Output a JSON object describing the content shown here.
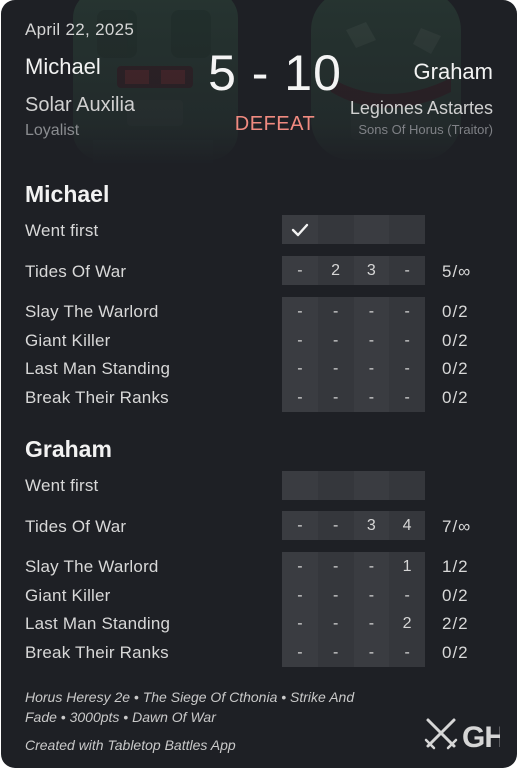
{
  "header": {
    "date": "April 22, 2025",
    "score": "5 - 10",
    "result": "DEFEAT",
    "player1": {
      "name": "Michael",
      "faction": "Solar Auxilia",
      "allegiance": "Loyalist"
    },
    "player2": {
      "name": "Graham",
      "faction": "Legiones Astartes",
      "sub": "Sons Of Horus (Traitor)"
    }
  },
  "sections": [
    {
      "title": "Michael",
      "went_first": {
        "label": "Went first",
        "checked": true,
        "check_icon": "checkmark-icon"
      },
      "rows": [
        {
          "label": "Tides Of War",
          "cells": [
            "-",
            "2",
            "3",
            "-"
          ],
          "total": "5/∞"
        },
        {
          "label": "Slay The Warlord",
          "cells": [
            "-",
            "-",
            "-",
            "-"
          ],
          "total": "0/2"
        },
        {
          "label": "Giant Killer",
          "cells": [
            "-",
            "-",
            "-",
            "-"
          ],
          "total": "0/2"
        },
        {
          "label": "Last Man Standing",
          "cells": [
            "-",
            "-",
            "-",
            "-"
          ],
          "total": "0/2"
        },
        {
          "label": "Break Their Ranks",
          "cells": [
            "-",
            "-",
            "-",
            "-"
          ],
          "total": "0/2"
        }
      ]
    },
    {
      "title": "Graham",
      "went_first": {
        "label": "Went first",
        "checked": false
      },
      "rows": [
        {
          "label": "Tides Of War",
          "cells": [
            "-",
            "-",
            "3",
            "4"
          ],
          "total": "7/∞"
        },
        {
          "label": "Slay The Warlord",
          "cells": [
            "-",
            "-",
            "-",
            "1"
          ],
          "total": "1/2"
        },
        {
          "label": "Giant Killer",
          "cells": [
            "-",
            "-",
            "-",
            "-"
          ],
          "total": "0/2"
        },
        {
          "label": "Last Man Standing",
          "cells": [
            "-",
            "-",
            "-",
            "2"
          ],
          "total": "2/2"
        },
        {
          "label": "Break Their Ranks",
          "cells": [
            "-",
            "-",
            "-",
            "-"
          ],
          "total": "0/2"
        }
      ]
    }
  ],
  "footer": {
    "details": "Horus Heresy 2e • The Siege Of Cthonia • Strike And Fade • 3000pts • Dawn Of War",
    "credit": "Created with Tabletop Battles App",
    "logo_text": "GH",
    "logo_icon": "crossed-swords-icon"
  },
  "colors": {
    "background": "#1e2025",
    "defeat": "#f08a80",
    "cell": "#3a3c41"
  }
}
